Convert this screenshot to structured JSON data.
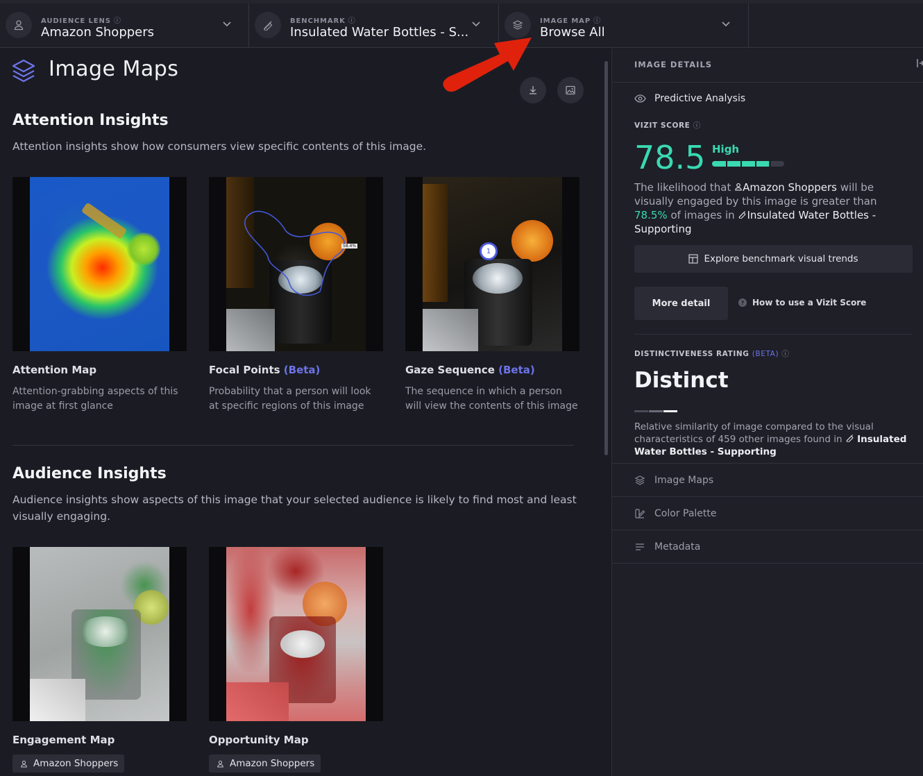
{
  "topbar": {
    "audience_lens": {
      "label": "AUDIENCE LENS",
      "value": "Amazon Shoppers",
      "info_icon": "ⓘ"
    },
    "benchmark": {
      "label": "BENCHMARK",
      "value": "Insulated Water Bottles - S...",
      "info_icon": "ⓘ"
    },
    "image_map": {
      "label": "IMAGE MAP",
      "value": "Browse All",
      "info_icon": "ⓘ"
    }
  },
  "main": {
    "title": "Image Maps",
    "attention": {
      "heading": "Attention Insights",
      "description": "Attention insights show how consumers view specific contents of this image.",
      "cards": [
        {
          "title": "Attention Map",
          "beta": "",
          "description": "Attention-grabbing aspects of this image at first glance"
        },
        {
          "title": "Focal Points",
          "beta": "(Beta)",
          "description": "Probability that a person will look at specific regions of this image"
        },
        {
          "title": "Gaze Sequence",
          "beta": "(Beta)",
          "description": "The sequence in which a person will view the contents of this image"
        }
      ],
      "focal_tag": "58.4%",
      "gaze_number": "1"
    },
    "audience": {
      "heading": "Audience Insights",
      "description": "Audience insights show aspects of this image that your selected audience is likely to find most and least visually engaging.",
      "cards": [
        {
          "title": "Engagement Map",
          "chip": "Amazon Shoppers"
        },
        {
          "title": "Opportunity Map",
          "chip": "Amazon Shoppers"
        }
      ]
    }
  },
  "panel": {
    "header": "IMAGE DETAILS",
    "section": "Predictive Analysis",
    "score_label": "VIZIT SCORE",
    "score": "78.5",
    "score_level": "High",
    "score_fraction": 0.785,
    "likely": {
      "p1": "The likelihood that",
      "audience": "Amazon Shoppers",
      "p2": "will be visually engaged by this image is greater than",
      "pct": "78.5%",
      "p3": "of images in",
      "benchmark": "Insulated Water Bottles - Supporting"
    },
    "explore": "Explore benchmark visual trends",
    "more_detail": "More detail",
    "how_to": "How to use a Vizit Score",
    "distinct_label": "DISTINCTIVENESS RATING",
    "distinct_beta": "(BETA)",
    "distinct_value": "Distinct",
    "similarity": {
      "p1": "Relative similarity of image compared to the visual characteristics of 459 other images found in",
      "benchmark": "Insulated Water Bottles - Supporting"
    },
    "nav": [
      "Image Maps",
      "Color Palette",
      "Metadata"
    ]
  },
  "colors": {
    "accent": "#3ad9b2",
    "beta": "#6c73e8",
    "arrow": "#e0220d"
  }
}
